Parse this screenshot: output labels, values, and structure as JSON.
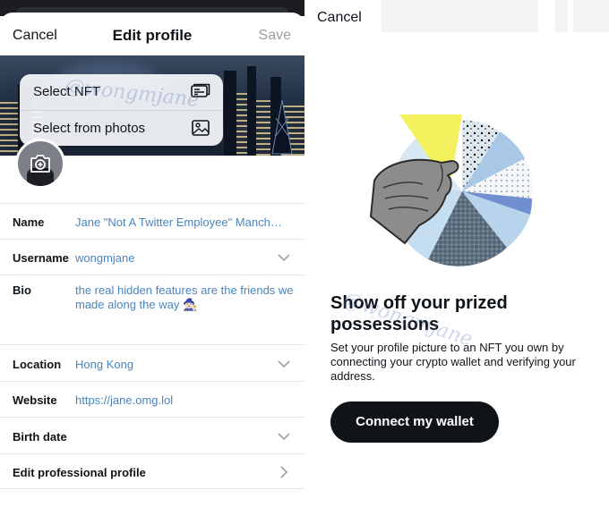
{
  "edit_profile": {
    "header": {
      "cancel": "Cancel",
      "title": "Edit profile",
      "save": "Save"
    },
    "photo_menu": {
      "items": [
        {
          "label": "Select NFT",
          "icon": "nft-card-icon"
        },
        {
          "label": "Select from photos",
          "icon": "photo-icon"
        }
      ]
    },
    "avatar_icon": "camera-plus-icon",
    "fields": [
      {
        "key": "name",
        "label": "Name",
        "value": "Jane \"Not A Twitter Employee\" Manch…",
        "control": "none"
      },
      {
        "key": "username",
        "label": "Username",
        "value": "wongmjane",
        "control": "chevron-down"
      },
      {
        "key": "bio",
        "label": "Bio",
        "value": "the real hidden features are the friends we made along the way 🧙🏻‍♀️",
        "control": "none"
      },
      {
        "key": "location",
        "label": "Location",
        "value": "Hong Kong",
        "control": "chevron-down"
      },
      {
        "key": "website",
        "label": "Website",
        "value": "https://jane.omg.lol",
        "control": "none"
      },
      {
        "key": "birth_date",
        "label": "Birth date",
        "value": "",
        "control": "chevron-down"
      },
      {
        "key": "professional",
        "label": "Edit professional profile",
        "value": "",
        "control": "chevron-right"
      }
    ]
  },
  "nft_intro": {
    "cancel": "Cancel",
    "illustration_icon": "hand-holding-pie-chart-illustration",
    "headline": "Show off your prized possessions",
    "description": "Set your profile picture to an NFT you own by connecting your crypto wallet and verifying your address.",
    "button": "Connect my wallet"
  },
  "watermark": "@wongmjane",
  "colors": {
    "link_blue": "#4b84bd",
    "primary": "#0f1419",
    "disabled": "#9aa0a6",
    "divider": "#e6e9ec"
  }
}
